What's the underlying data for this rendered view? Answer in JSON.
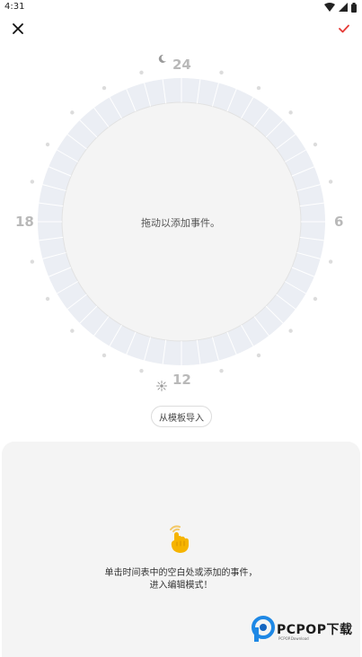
{
  "status_bar": {
    "time": "4:31"
  },
  "top_bar": {
    "close_icon": "close-icon",
    "confirm_icon": "check-icon",
    "accent_color": "#e53935"
  },
  "clock": {
    "hour_labels": {
      "top": "24",
      "right": "6",
      "bottom": "12",
      "left": "18"
    },
    "center_text": "拖动以添加事件。",
    "night_icon": "moon-icon",
    "day_icon": "sun-icon"
  },
  "template_button": {
    "label": "从模板导入"
  },
  "hint_panel": {
    "hand_icon": "tap-hand-icon",
    "line1": "单击时间表中的空白处或添加的事件，",
    "line2": "进入编辑模式！"
  },
  "watermark": {
    "brand": "PCPOP下载",
    "sub": "PCPOP.Download"
  }
}
